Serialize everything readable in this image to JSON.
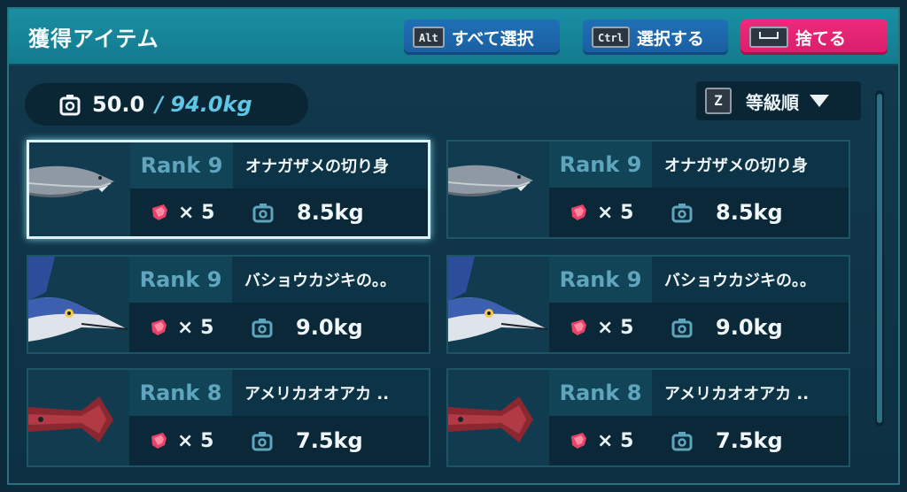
{
  "header": {
    "title": "獲得アイテム",
    "buttons": [
      {
        "key": "Alt",
        "label": "すべて選択"
      },
      {
        "key": "Ctrl",
        "label": "選択する"
      },
      {
        "key": "",
        "label": "捨てる"
      }
    ]
  },
  "weight": {
    "current": "50.0",
    "max": "/ 94.0kg"
  },
  "sort": {
    "key": "Z",
    "label": "等級順"
  },
  "items": [
    {
      "rank": "Rank 9",
      "name": "オナガザメの切り身",
      "qty": "× 5",
      "weight": "8.5kg",
      "thumb": "shark",
      "selected": true
    },
    {
      "rank": "Rank 9",
      "name": "オナガザメの切り身",
      "qty": "× 5",
      "weight": "8.5kg",
      "thumb": "shark",
      "selected": false
    },
    {
      "rank": "Rank 9",
      "name": "バショウカジキの。。",
      "qty": "× 5",
      "weight": "9.0kg",
      "thumb": "marlin",
      "selected": false
    },
    {
      "rank": "Rank 9",
      "name": "バショウカジキの。。",
      "qty": "× 5",
      "weight": "9.0kg",
      "thumb": "marlin",
      "selected": false
    },
    {
      "rank": "Rank 8",
      "name": "アメリカオオアカ ..",
      "qty": "× 5",
      "weight": "7.5kg",
      "thumb": "squid",
      "selected": false
    },
    {
      "rank": "Rank 8",
      "name": "アメリカオオアカ ..",
      "qty": "× 5",
      "weight": "7.5kg",
      "thumb": "squid",
      "selected": false
    }
  ],
  "colors": {
    "accent": "#1a8fa3",
    "discard": "#ee2a7b",
    "rank": "#5fa5bd",
    "maxWeight": "#5fc6e6"
  }
}
